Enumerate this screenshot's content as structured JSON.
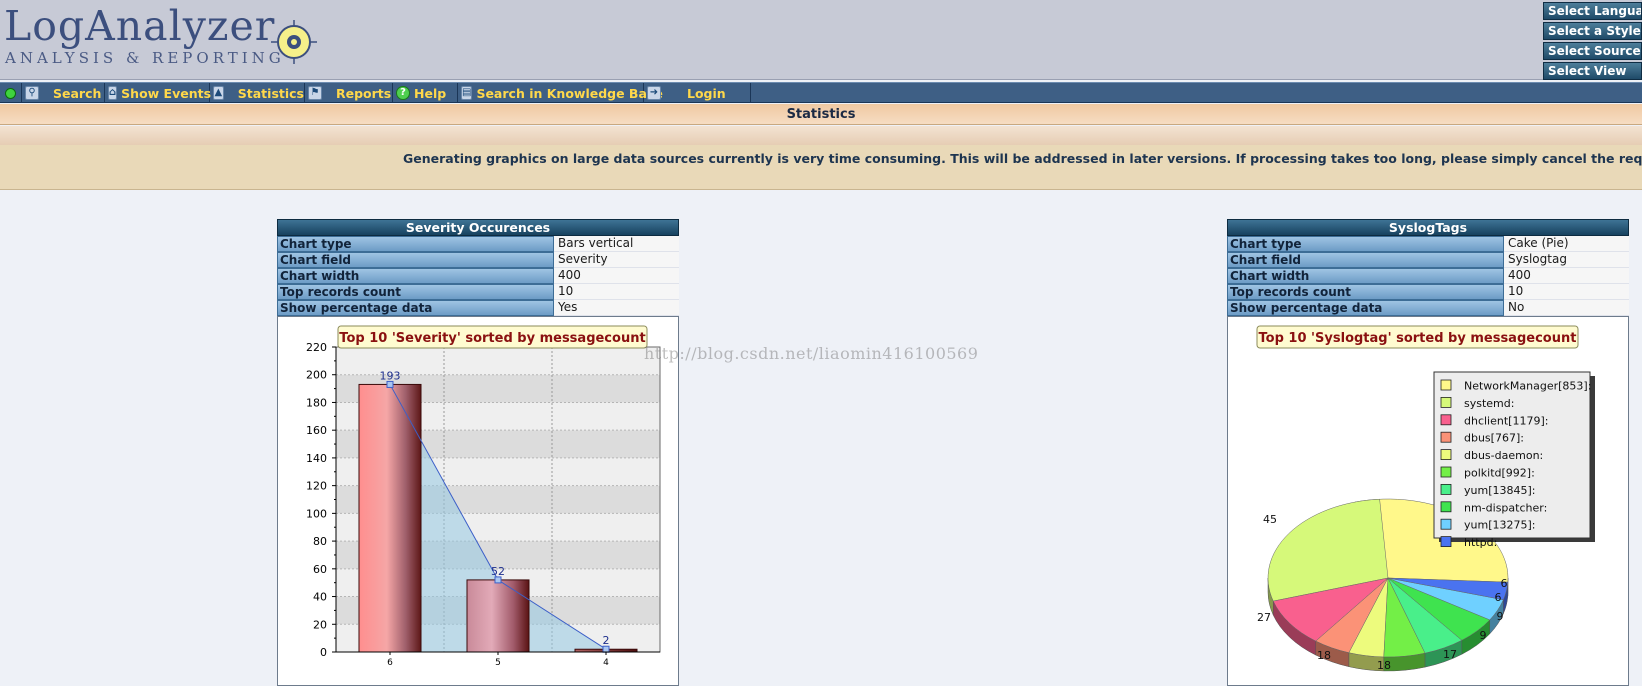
{
  "brand": {
    "title": "LogAnalyzer",
    "subtitle": "ANALYSIS & REPORTING"
  },
  "side_buttons": [
    "Select Language",
    "Select a Style",
    "Select Source",
    "Select View"
  ],
  "menu": [
    {
      "icon": "status-dot-icon",
      "label": ""
    },
    {
      "icon": "magnifier-icon",
      "label": "Search"
    },
    {
      "icon": "home-icon",
      "label": "Show Events"
    },
    {
      "icon": "chart-icon",
      "label": "Statistics"
    },
    {
      "icon": "flag-icon",
      "label": "Reports"
    },
    {
      "icon": "help-icon",
      "label": "Help"
    },
    {
      "icon": "book-icon",
      "label": "Search in Knowledge Base"
    },
    {
      "icon": "login-icon",
      "label": "Login"
    }
  ],
  "page_title": "Statistics",
  "notice": "Generating graphics on large data sources currently is very time consuming. This will be addressed in later versions. If processing takes too long, please simply cancel the request.",
  "watermark": "http://blog.csdn.net/liaomin416100569",
  "panels": [
    {
      "title": "Severity Occurences",
      "rows": [
        [
          "Chart type",
          "Bars vertical"
        ],
        [
          "Chart field",
          "Severity"
        ],
        [
          "Chart width",
          "400"
        ],
        [
          "Top records count",
          "10"
        ],
        [
          "Show percentage data",
          "Yes"
        ]
      ]
    },
    {
      "title": "SyslogTags",
      "rows": [
        [
          "Chart type",
          "Cake (Pie)"
        ],
        [
          "Chart field",
          "Syslogtag"
        ],
        [
          "Chart width",
          "400"
        ],
        [
          "Top records count",
          "10"
        ],
        [
          "Show percentage data",
          "No"
        ]
      ]
    }
  ],
  "colors": {
    "header": "#c7cad6",
    "menu": "#3e5f85",
    "menu_text": "#ffd84a",
    "panel_head": "#1f4a68"
  },
  "chart_data": [
    {
      "type": "bar",
      "title": "Top 10 'Severity' sorted by messagecount",
      "categories": [
        "6",
        "5",
        "4"
      ],
      "values": [
        193,
        52,
        2
      ],
      "ylim": [
        0,
        220
      ],
      "yticks": [
        0,
        20,
        40,
        60,
        80,
        100,
        120,
        140,
        160,
        180,
        200,
        220
      ],
      "grid": true
    },
    {
      "type": "pie",
      "title": "Top 10 'Syslogtag' sorted by messagecount",
      "legend_position": "top-right",
      "labels": [
        "NetworkManager[853]:",
        "systemd:",
        "dhclient[1179]:",
        "dbus[767]:",
        "dbus-daemon:",
        "polkitd[992]:",
        "yum[13845]:",
        "nm-dispatcher:",
        "yum[13275]:",
        "httpd:"
      ],
      "values": [
        null,
        45,
        27,
        18,
        18,
        17,
        9,
        9,
        6,
        6
      ],
      "colors": [
        "#fff88a",
        "#d6f97a",
        "#f9608e",
        "#fb9277",
        "#edfb7d",
        "#73ef47",
        "#49ef8a",
        "#3fe34f",
        "#6fd0ff",
        "#4a73f0"
      ]
    }
  ]
}
